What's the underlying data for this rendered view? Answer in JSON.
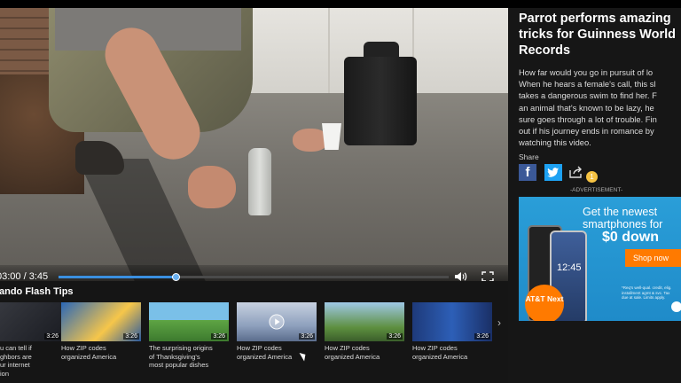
{
  "video": {
    "time_display": "03:00 / 3:45",
    "progress_fraction": 0.3,
    "volume_icon": "volume-icon",
    "fullscreen_icon": "fullscreen-icon"
  },
  "article": {
    "title": "Parrot performs amazing\ntricks for Guinness World\nRecords",
    "description": "How far would you go in pursuit of lo\nWhen he hears a female's call, this sl\ntakes a dangerous swim to find her. F\nan animal that's known to be lazy, he\nsure goes through a lot of trouble. Fin\nout if his journey ends in romance by\nwatching this video.",
    "share_label": "Share",
    "share_badge": "1"
  },
  "ad": {
    "label": "-ADVERTISEMENT-",
    "line1": "Get the newest",
    "line2": "smartphones for",
    "line3": "$0 down",
    "cta": "Shop now",
    "phone_time": "12:45",
    "brand": "AT&T Next",
    "fine_print": "*Req's well-qual. credit, elig. installment agmt & svc. Tax due at sale. Limits apply."
  },
  "playlist": {
    "title": "ando Flash Tips",
    "items": [
      {
        "duration": "3:26",
        "caption": "u can tell if\nghbors are\nur internet\nion"
      },
      {
        "duration": "3:26",
        "caption": "How ZIP codes\norganized America"
      },
      {
        "duration": "3:26",
        "caption": "The surprising origins\nof Thanksgiving's\nmost popular dishes"
      },
      {
        "duration": "3:26",
        "caption": "How ZIP codes\norganized America"
      },
      {
        "duration": "3:26",
        "caption": "How ZIP codes\norganized America"
      },
      {
        "duration": "3:26",
        "caption": "How ZIP codes\norganized America"
      }
    ]
  },
  "colors": {
    "progress": "#3a8fe0",
    "facebook": "#3b5998",
    "twitter": "#1da1f2",
    "ad_bg": "#2a9ed8",
    "cta": "#ff7a00"
  }
}
